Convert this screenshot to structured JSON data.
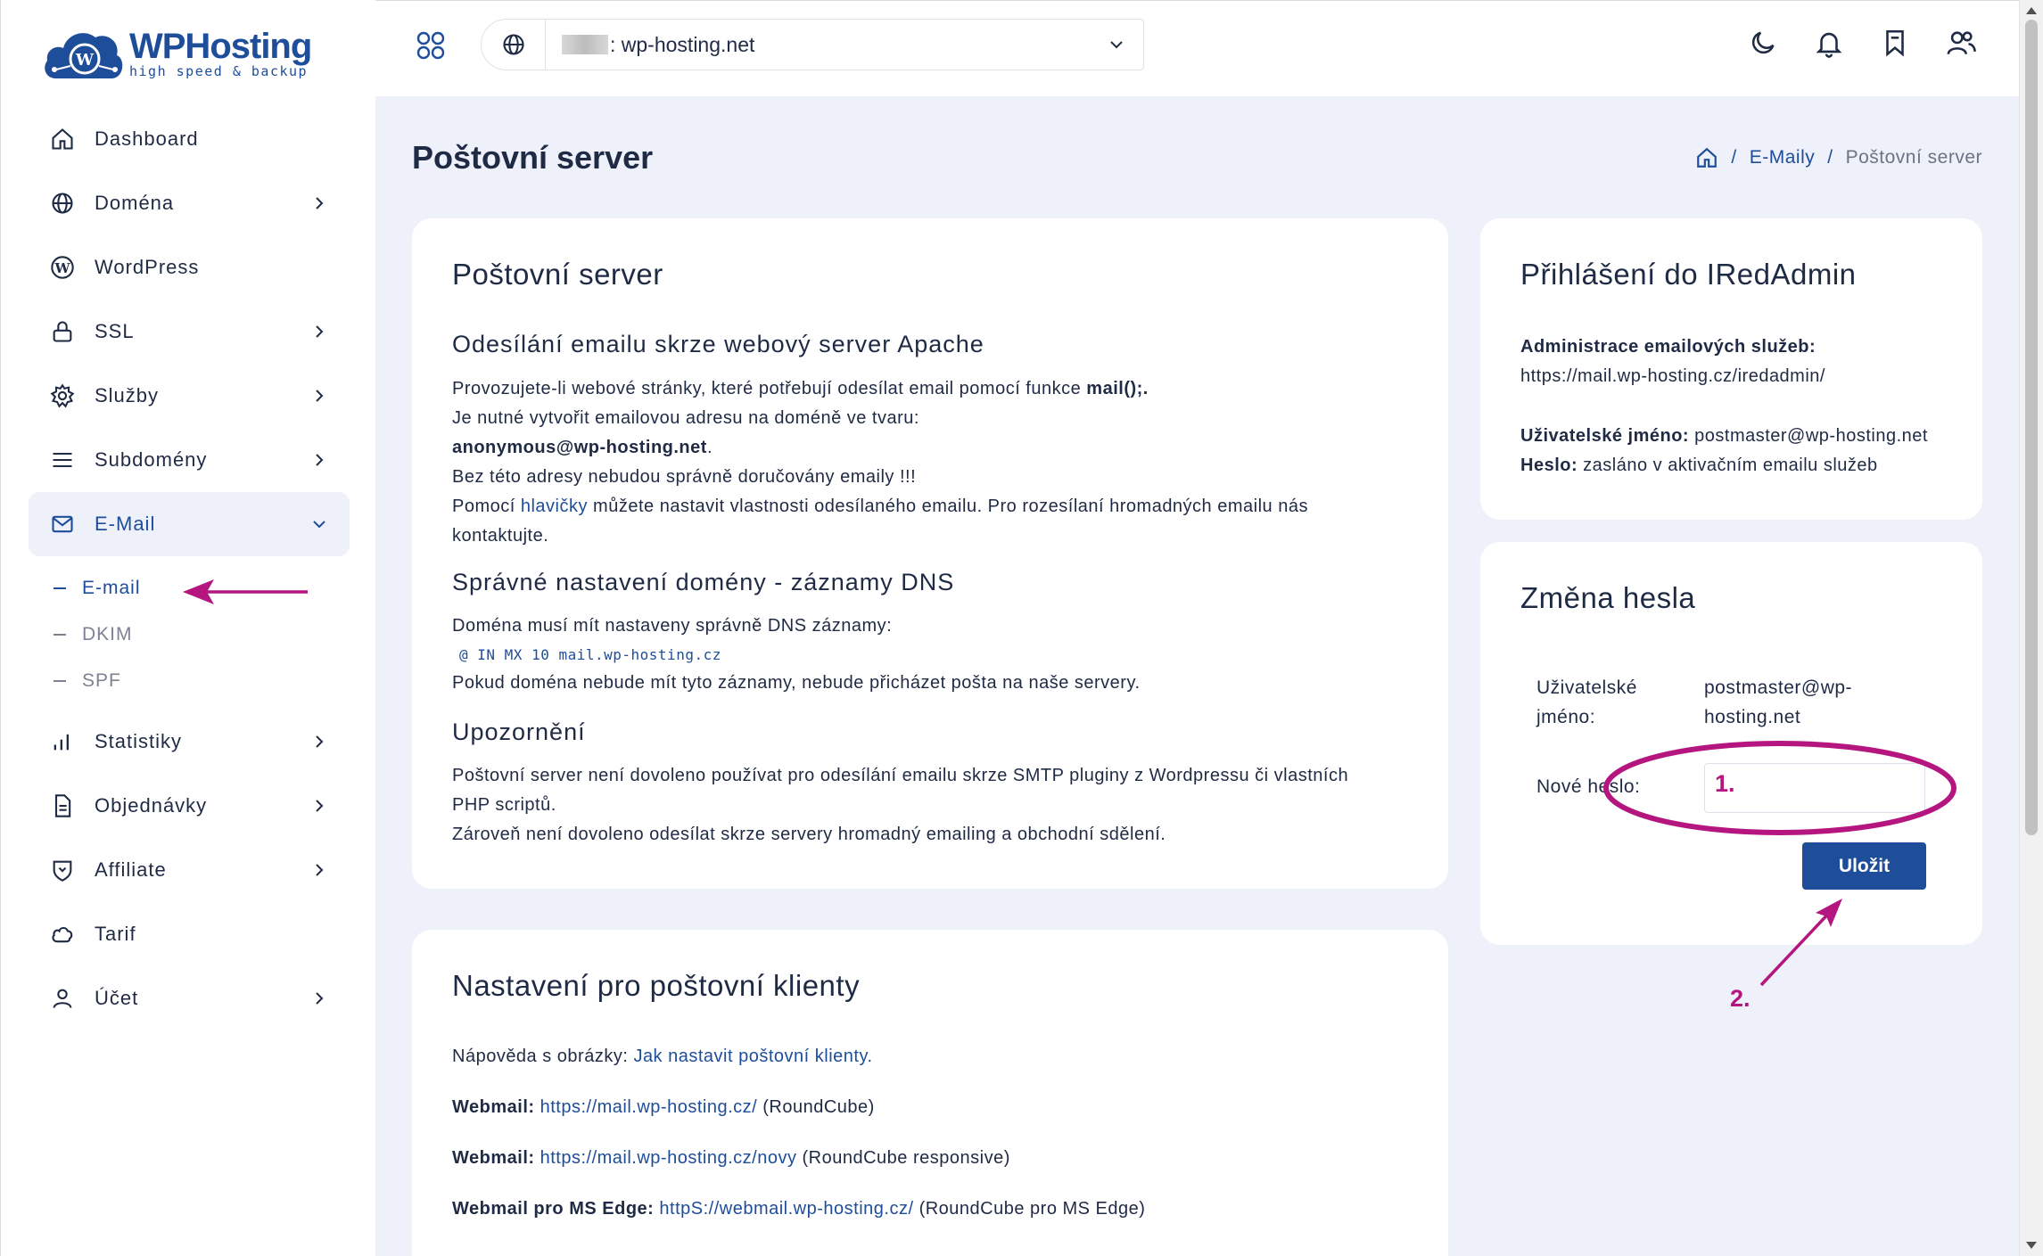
{
  "brand": {
    "title": "WPHosting",
    "subtitle": "high speed & backup"
  },
  "sidebar": {
    "items": [
      {
        "label": "Dashboard",
        "icon": "home-icon",
        "chevron": false
      },
      {
        "label": "Doména",
        "icon": "globe-icon",
        "chevron": true
      },
      {
        "label": "WordPress",
        "icon": "wordpress-icon",
        "chevron": false
      },
      {
        "label": "SSL",
        "icon": "lock-icon",
        "chevron": true
      },
      {
        "label": "Služby",
        "icon": "gear-icon",
        "chevron": true
      },
      {
        "label": "Subdomény",
        "icon": "menu-icon",
        "chevron": true
      },
      {
        "label": "E-Mail",
        "icon": "envelope-icon",
        "chevron": true,
        "active": true
      },
      {
        "label": "Statistiky",
        "icon": "bar-chart-icon",
        "chevron": true
      },
      {
        "label": "Objednávky",
        "icon": "document-icon",
        "chevron": true
      },
      {
        "label": "Affiliate",
        "icon": "shield-heart-icon",
        "chevron": true
      },
      {
        "label": "Tarif",
        "icon": "cloud-icon",
        "chevron": false
      },
      {
        "label": "Účet",
        "icon": "user-icon",
        "chevron": true
      }
    ],
    "email_sub": [
      {
        "label": "E-mail",
        "active": true
      },
      {
        "label": "DKIM"
      },
      {
        "label": "SPF"
      }
    ]
  },
  "topbar": {
    "domain_suffix": ": wp-hosting.net",
    "icons": [
      "moon-icon",
      "bell-icon",
      "bookmark-icon",
      "users-icon"
    ]
  },
  "header": {
    "title": "Poštovní server",
    "breadcrumb": {
      "link": "E-Maily",
      "current": "Poštovní server",
      "sep": "/"
    }
  },
  "mail_card": {
    "title": "Poštovní server",
    "sec1": {
      "heading": "Odesílání emailu skrze webový server Apache",
      "l1a": "Provozujete-li webové stránky, které potřebují odesílat email pomocí funkce ",
      "l1b": "mail();",
      "l1c": ".",
      "l2": "Je nutné vytvořit emailovou adresu na doméně ve tvaru:",
      "l3": "anonymous@wp-hosting.net",
      "l3b": ".",
      "l4": "Bez této adresy nebudou správně doručovány emaily !!!",
      "l5a": "Pomocí ",
      "l5link": "hlavičky",
      "l5b": " můžete nastavit vlastnosti odesílaného emailu. Pro rozesílaní hromadných emailu nás",
      "l6": "kontaktujte."
    },
    "sec2": {
      "heading": "Správné nastavení domény - záznamy DNS",
      "l1": "Doména musí mít nastaveny správně DNS záznamy:",
      "code": "@ IN MX 10 mail.wp-hosting.cz",
      "l2": "Pokud doména nebude mít tyto záznamy, nebude přicházet pošta na naše servery."
    },
    "sec3": {
      "heading": "Upozornění",
      "l1": "Poštovní server není dovoleno používat pro odesílání emailu skrze SMTP pluginy z Wordpressu či vlastních",
      "l2": "PHP scriptů.",
      "l3": "Zároveň není dovoleno odesílat skrze servery hromadný emailing a obchodní sdělení."
    }
  },
  "clients_card": {
    "title": "Nastavení pro poštovní klienty",
    "help_label": "Nápověda s obrázky: ",
    "help_link": "Jak nastavit poštovní klienty.",
    "rows": [
      {
        "label": "Webmail:",
        "url": "https://mail.wp-hosting.cz/",
        "note": " (RoundCube)"
      },
      {
        "label": "Webmail:",
        "url": "https://mail.wp-hosting.cz/novy",
        "note": " (RoundCube responsive)"
      },
      {
        "label": "Webmail pro MS Edge:",
        "url": "httpS://webmail.wp-hosting.cz/",
        "note": " (RoundCube pro MS Edge)"
      }
    ]
  },
  "iredadmin_card": {
    "title": "Přihlášení do IRedAdmin",
    "admin_label": "Administrace emailových služeb:",
    "admin_url": "https://mail.wp-hosting.cz/iredadmin/",
    "user_label": "Uživatelské jméno:",
    "user_value": " postmaster@wp-hosting.net",
    "pass_label": "Heslo:",
    "pass_value": " zasláno v aktivačním emailu služeb"
  },
  "password_card": {
    "title": "Změna hesla",
    "user_label_1": "Uživatelské",
    "user_label_2": "jméno:",
    "user_value_1": "postmaster@wp-",
    "user_value_2": "hosting.net",
    "new_pass_label": "Nové heslo:",
    "save_label": "Uložit"
  },
  "annotations": {
    "step1": "1.",
    "step2": "2.",
    "accent": "#b5157f"
  }
}
